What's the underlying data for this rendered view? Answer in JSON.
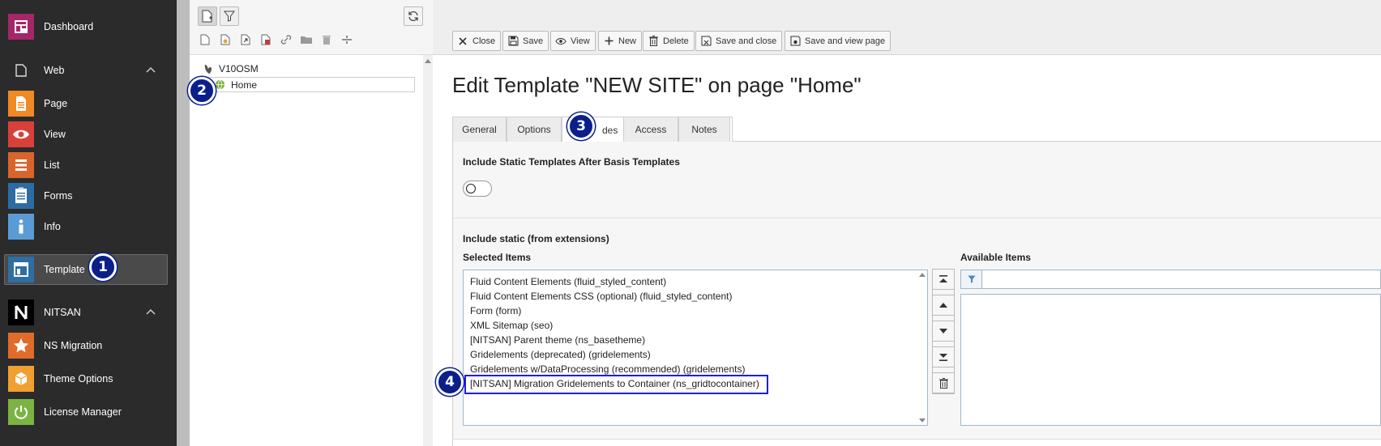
{
  "sidebar": {
    "items": [
      {
        "label": "Dashboard",
        "icon": "dashboard-icon",
        "color": "#a4276a"
      },
      {
        "label": "Web",
        "icon": "file-icon",
        "group": true
      },
      {
        "label": "Page",
        "icon": "page-icon",
        "color": "#f08a24"
      },
      {
        "label": "View",
        "icon": "eye-icon",
        "color": "#d9403a"
      },
      {
        "label": "List",
        "icon": "list-icon",
        "color": "#d8662c"
      },
      {
        "label": "Forms",
        "icon": "forms-icon",
        "color": "#2d6ca3"
      },
      {
        "label": "Info",
        "icon": "info-icon",
        "color": "#5b9bd5"
      },
      {
        "label": "Template",
        "icon": "template-icon",
        "color": "#2f6ea3",
        "active": true
      },
      {
        "label": "NITSAN",
        "icon": "nitsan-logo-icon",
        "group": true
      },
      {
        "label": "NS Migration",
        "icon": "star-icon",
        "color": "#e06c2b"
      },
      {
        "label": "Theme Options",
        "icon": "cube-icon",
        "color": "#f0a030"
      },
      {
        "label": "License Manager",
        "icon": "power-icon",
        "color": "#7cb342"
      }
    ]
  },
  "tree": {
    "root": "V10OSM",
    "node": "Home"
  },
  "docheader": {
    "buttons": [
      {
        "label": "Close",
        "icon": "close-icon"
      },
      {
        "label": "Save",
        "icon": "save-icon"
      },
      {
        "label": "View",
        "icon": "eye-icon"
      },
      {
        "label": "New",
        "icon": "plus-icon"
      },
      {
        "label": "Delete",
        "icon": "trash-icon"
      },
      {
        "label": "Save and close",
        "icon": "save-close-icon"
      },
      {
        "label": "Save and view page",
        "icon": "save-view-icon"
      }
    ]
  },
  "content": {
    "title": "Edit Template \"NEW SITE\" on page \"Home\"",
    "tabs": [
      "General",
      "Options",
      "Includes",
      "Access",
      "Notes"
    ],
    "active_tab": "Includes",
    "tab_visible": [
      "General",
      "Options",
      "des",
      "Access",
      "Notes"
    ],
    "static_after_label": "Include Static Templates After Basis Templates",
    "include_static_label": "Include static (from extensions)",
    "selected_label": "Selected Items",
    "available_label": "Available Items",
    "selected_items": [
      "Fluid Content Elements (fluid_styled_content)",
      "Fluid Content Elements CSS (optional) (fluid_styled_content)",
      "Form (form)",
      "XML Sitemap (seo)",
      "[NITSAN] Parent theme (ns_basetheme)",
      "Gridelements (deprecated) (gridelements)",
      "Gridelements w/DataProcessing (recommended) (gridelements)",
      "[NITSAN] Migration Gridelements to Container (ns_gridtocontainer)"
    ],
    "filter_value": ""
  },
  "markers": [
    "1",
    "2",
    "3",
    "4"
  ]
}
